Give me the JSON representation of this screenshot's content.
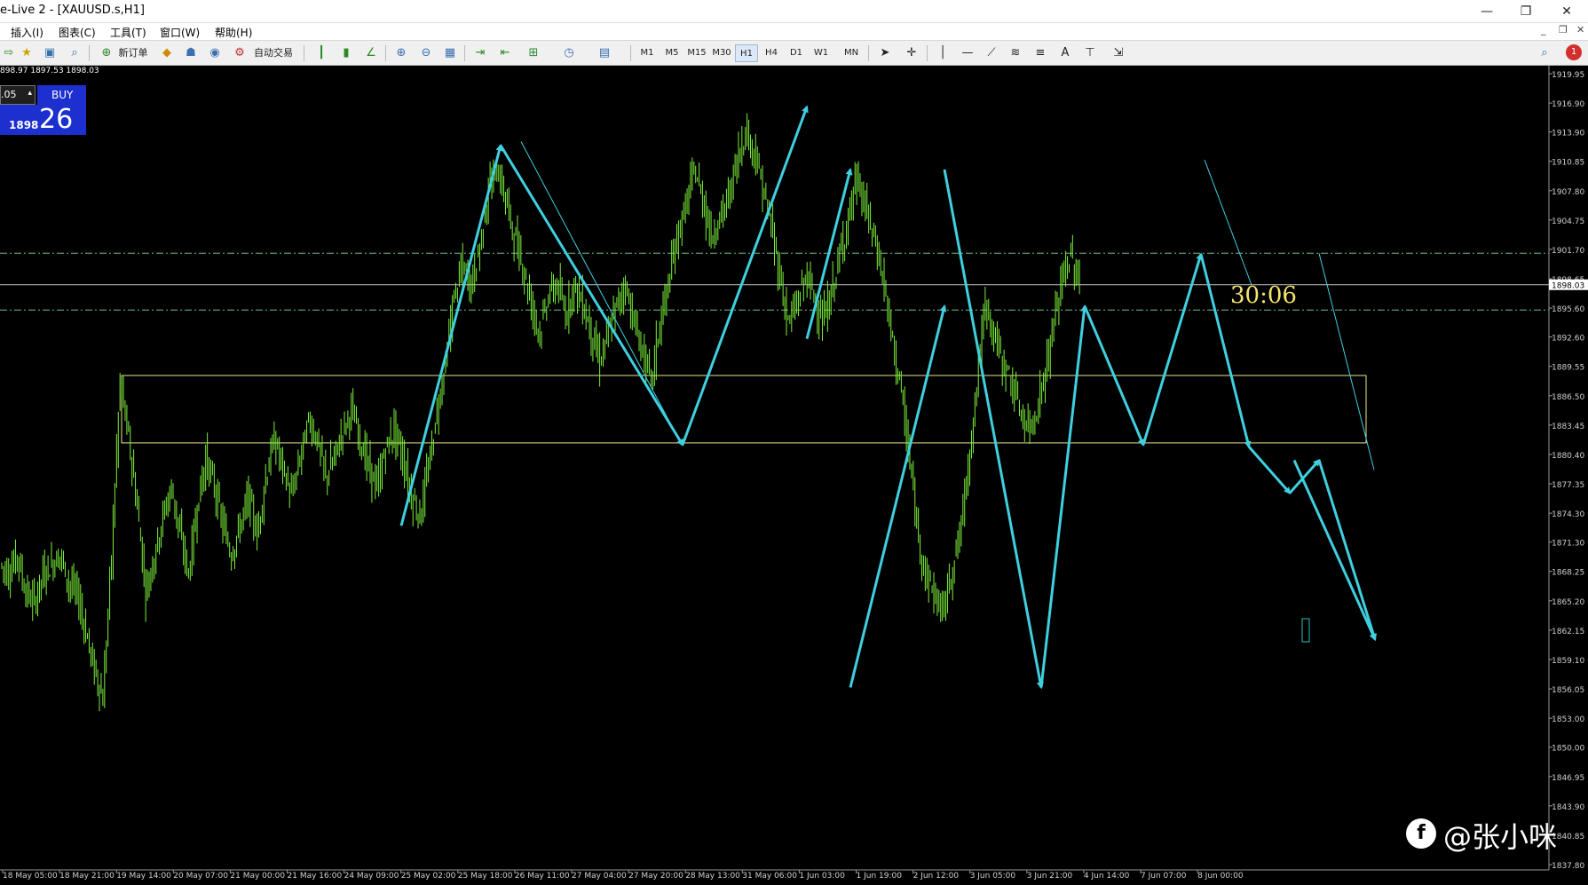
{
  "window": {
    "title": "e-Live 2 - [XAUUSD.s,H1]",
    "minimize": "—",
    "maximize": "❐",
    "close": "✕",
    "mdi_minimize": "_",
    "mdi_restore": "❐",
    "mdi_close": "✕"
  },
  "menu": [
    "插入(I)",
    "图表(C)",
    "工具(T)",
    "窗口(W)",
    "帮助(H)"
  ],
  "toolbar": {
    "new_order": "新订单",
    "auto_trade": "自动交易",
    "timeframes": [
      "M1",
      "M5",
      "M15",
      "M30",
      "H1",
      "H4",
      "D1",
      "W1",
      "MN"
    ],
    "active_timeframe": "H1",
    "text_tool": "A",
    "notification_count": "1"
  },
  "one_click": {
    "lot": ".05",
    "buy_label": "BUY",
    "price_small": "1898",
    "price_big": "26"
  },
  "ohlc": "898.97 1897.53 1898.03",
  "chart_data": {
    "type": "line",
    "symbol": "XAUUSD.s",
    "timeframe": "H1",
    "ylim": [
      1837.8,
      1919.95
    ],
    "price_ticks": [
      "1919.95",
      "1916.90",
      "1913.90",
      "1910.85",
      "1907.80",
      "1904.75",
      "1901.70",
      "1898.65",
      "1895.60",
      "1892.60",
      "1889.55",
      "1886.50",
      "1883.45",
      "1880.40",
      "1877.35",
      "1874.30",
      "1871.30",
      "1868.25",
      "1865.20",
      "1862.15",
      "1859.10",
      "1856.05",
      "1853.00",
      "1850.00",
      "1846.95",
      "1843.90",
      "1840.85",
      "1837.80"
    ],
    "current_price": "1898.03",
    "time_ticks": [
      "18 May 05:00",
      "18 May 21:00",
      "19 May 14:00",
      "20 May 07:00",
      "21 May 00:00",
      "21 May 16:00",
      "24 May 09:00",
      "25 May 02:00",
      "25 May 18:00",
      "26 May 11:00",
      "27 May 04:00",
      "27 May 20:00",
      "28 May 13:00",
      "31 May 06:00",
      "1 Jun 03:00",
      "1 Jun 19:00",
      "2 Jun 12:00",
      "3 Jun 05:00",
      "3 Jun 21:00",
      "4 Jun 14:00",
      "7 Jun 07:00",
      "8 Jun 00:00"
    ],
    "countdown": "30:06",
    "price_series": [
      1869,
      1868,
      1870,
      1866,
      1865,
      1868,
      1869,
      1870,
      1867,
      1866,
      1862,
      1858,
      1855,
      1870,
      1888,
      1882,
      1875,
      1866,
      1870,
      1874,
      1877,
      1872,
      1868,
      1875,
      1880,
      1877,
      1873,
      1870,
      1873,
      1876,
      1872,
      1878,
      1882,
      1879,
      1876,
      1880,
      1884,
      1882,
      1878,
      1880,
      1883,
      1885,
      1882,
      1879,
      1877,
      1881,
      1883,
      1880,
      1876,
      1874,
      1879,
      1885,
      1890,
      1897,
      1900,
      1898,
      1902,
      1908,
      1910,
      1907,
      1903,
      1900,
      1896,
      1893,
      1897,
      1898,
      1895,
      1898,
      1896,
      1893,
      1890,
      1893,
      1896,
      1898,
      1894,
      1891,
      1888,
      1894,
      1898,
      1903,
      1906,
      1910,
      1907,
      1903,
      1905,
      1907,
      1911,
      1914,
      1912,
      1908,
      1904,
      1899,
      1894,
      1896,
      1899,
      1897,
      1894,
      1897,
      1901,
      1905,
      1909,
      1906,
      1903,
      1899,
      1893,
      1888,
      1881,
      1873,
      1868,
      1866,
      1864,
      1868,
      1872,
      1879,
      1888,
      1896,
      1893,
      1890,
      1888,
      1885,
      1883,
      1885,
      1889,
      1894,
      1899,
      1901,
      1898
    ],
    "zigzag_thick": [
      [
        1873,
        1912.5
      ],
      [
        1881.4,
        1916.5
      ],
      [
        1892.4,
        1910.0
      ],
      [
        1856.2,
        1895.8
      ],
      [
        1881.4,
        1901.2
      ],
      [
        1881.2,
        1876.4
      ],
      [
        1879.8,
        1861.2
      ]
    ],
    "zigzag_thin": [
      [
        1912.9,
        1881.4
      ],
      [
        1911.0,
        1898.0
      ],
      [
        1901.3,
        1878.8
      ]
    ],
    "levels": {
      "resistance_dashdot": 1901.3,
      "support_dashdot": 1895.4,
      "current": 1898.03
    },
    "range_box": [
      1888.6,
      1881.6
    ]
  },
  "watermark": {
    "logo": "f",
    "text": "@张小咪"
  }
}
